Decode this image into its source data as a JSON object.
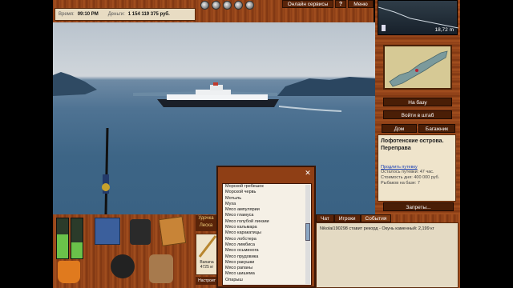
{
  "topbar": {
    "time_label": "Время:",
    "time_value": "09:10 PM",
    "money_label": "Деньги:",
    "money_value": "1 154 119 375 руб.",
    "online_services": "Онлайн сервисы",
    "help": "?",
    "menu": "Меню"
  },
  "right": {
    "depth_value": "18,72 m",
    "to_base": "На базу",
    "headquarters": "Войти в штаб",
    "home": "Дом",
    "luggage": "Багажник",
    "location_title": "Лофотенские острова. Переправа",
    "extend_link": "Продлить путевку",
    "remaining": "Осталось путевки: 47 час.",
    "day_cost": "Стоимость дня: 400 000 руб.",
    "fish_on_base": "Рыбаков на базе: 7",
    "restrictions": "Запреты..."
  },
  "bottom": {
    "rod_tab": "Удочка",
    "rod_tab2": "Леска",
    "item_name": "Banana",
    "item_weight": "4725 кг",
    "settings_btn": "Настроит"
  },
  "chat": {
    "tabs": [
      "Чат",
      "Игроки",
      "События"
    ],
    "message": "Nikolai190298 ставит рекорд - Окунь каменный: 2,199 кг"
  },
  "popup": {
    "close": "✕",
    "items": [
      "Морской гребешок",
      "Морской червь",
      "Мотыль",
      "Муха",
      "Мясо ампулярии",
      "Мясо гламуса",
      "Мясо голубой линзии",
      "Мясо кальмара",
      "Мясо каракатицы",
      "Мясо лобстера",
      "Мясо лимбиса",
      "Мясо осьминога",
      "Мясо прудовика",
      "Мясо ракушки",
      "Мясо рапаны",
      "Мясо шишема",
      "Опарыш"
    ]
  },
  "colors": {
    "wood": "#8a3d16",
    "panel": "#efe4cb",
    "link": "#1a3fb5"
  }
}
